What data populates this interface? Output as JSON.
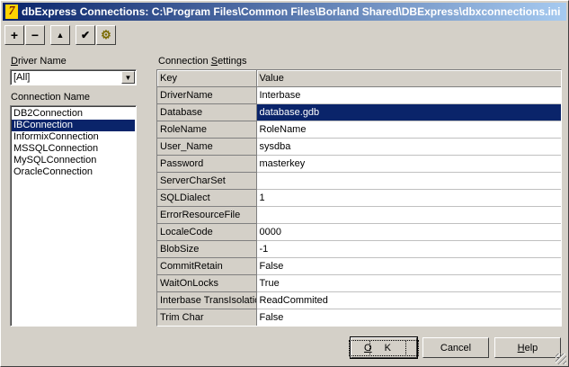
{
  "window": {
    "title": "dbExpress Connections: C:\\Program Files\\Common Files\\Borland Shared\\DBExpress\\dbxconnections.ini"
  },
  "toolbar": {
    "buttons": [
      {
        "icon": "plus-icon",
        "glyph": "+"
      },
      {
        "icon": "minus-icon",
        "glyph": "−"
      },
      {
        "icon": "triangle-up-icon",
        "glyph": "▲"
      },
      {
        "icon": "check-icon",
        "glyph": "✔"
      },
      {
        "icon": "gear-icon",
        "glyph": "⚙"
      }
    ]
  },
  "driver": {
    "label_prefix": "D",
    "label_rest": "river Name",
    "selected": "[All]"
  },
  "connections": {
    "label": "Connection Name",
    "items": [
      "DB2Connection",
      "IBConnection",
      "InformixConnection",
      "MSSQLConnection",
      "MySQLConnection",
      "OracleConnection"
    ],
    "selected_index": 1
  },
  "settings": {
    "label_before": "Connection ",
    "label_underlined": "S",
    "label_after": "ettings",
    "headers": {
      "key": "Key",
      "value": "Value"
    },
    "rows": [
      {
        "key": "DriverName",
        "value": "Interbase"
      },
      {
        "key": "Database",
        "value": "database.gdb",
        "selected": true
      },
      {
        "key": "RoleName",
        "value": "RoleName"
      },
      {
        "key": "User_Name",
        "value": "sysdba"
      },
      {
        "key": "Password",
        "value": "masterkey"
      },
      {
        "key": "ServerCharSet",
        "value": ""
      },
      {
        "key": "SQLDialect",
        "value": "1"
      },
      {
        "key": "ErrorResourceFile",
        "value": ""
      },
      {
        "key": "LocaleCode",
        "value": "0000"
      },
      {
        "key": "BlobSize",
        "value": "-1"
      },
      {
        "key": "CommitRetain",
        "value": "False"
      },
      {
        "key": "WaitOnLocks",
        "value": "True"
      },
      {
        "key": "Interbase TransIsolation",
        "value": "ReadCommited"
      },
      {
        "key": "Trim Char",
        "value": "False"
      }
    ]
  },
  "buttons": {
    "ok": {
      "underlined": "O",
      "rest": "K"
    },
    "cancel": "Cancel",
    "help": {
      "underlined": "H",
      "rest": "elp"
    }
  }
}
